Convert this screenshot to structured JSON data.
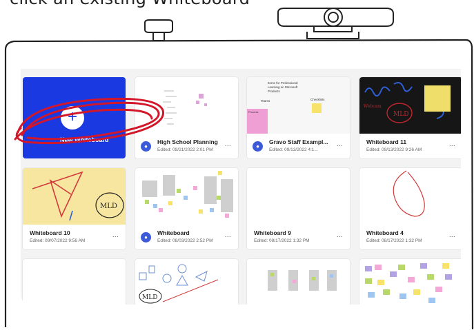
{
  "caption": "click an existing Whiteboard",
  "new_card": {
    "label": "New Whiteboard",
    "plus": "+"
  },
  "cards": [
    {
      "title": "High School Planning",
      "edited": "Edited: 09/21/2022 2:01 PM",
      "more": "...",
      "shared": true
    },
    {
      "title": "Gravo Staff Exampl...",
      "edited": "Edited: 09/13/2022 4:1...",
      "more": "...",
      "shared": true,
      "thumb_text": [
        "Items for Professional",
        "Learning on Microsoft",
        "Products",
        "Teams",
        "Checklists",
        "Process"
      ]
    },
    {
      "title": "Whiteboard 11",
      "edited": "Edited: 09/13/2022 9:26 AM",
      "more": "...",
      "shared": false,
      "thumb_text": [
        "MLD",
        "Webcam"
      ]
    },
    {
      "title": "Whiteboard 10",
      "edited": "Edited: 09/07/2022 9:56 AM",
      "more": "...",
      "shared": false,
      "thumb_text": [
        "MLD"
      ]
    },
    {
      "title": "Whiteboard",
      "edited": "Edited: 08/03/2022 2:52 PM",
      "more": "...",
      "shared": true
    },
    {
      "title": "Whiteboard 9",
      "edited": "Edited: 08/17/2022 1:32 PM",
      "more": "...",
      "shared": false
    },
    {
      "title": "Whiteboard 4",
      "edited": "Edited: 08/17/2022 1:32 PM",
      "more": "...",
      "shared": false
    }
  ],
  "bottom_row_thumb_text": [
    "MLD"
  ],
  "colors": {
    "accent": "#1a39e0",
    "annotation": "#d3172a",
    "avatar": "#3d5bd9"
  }
}
